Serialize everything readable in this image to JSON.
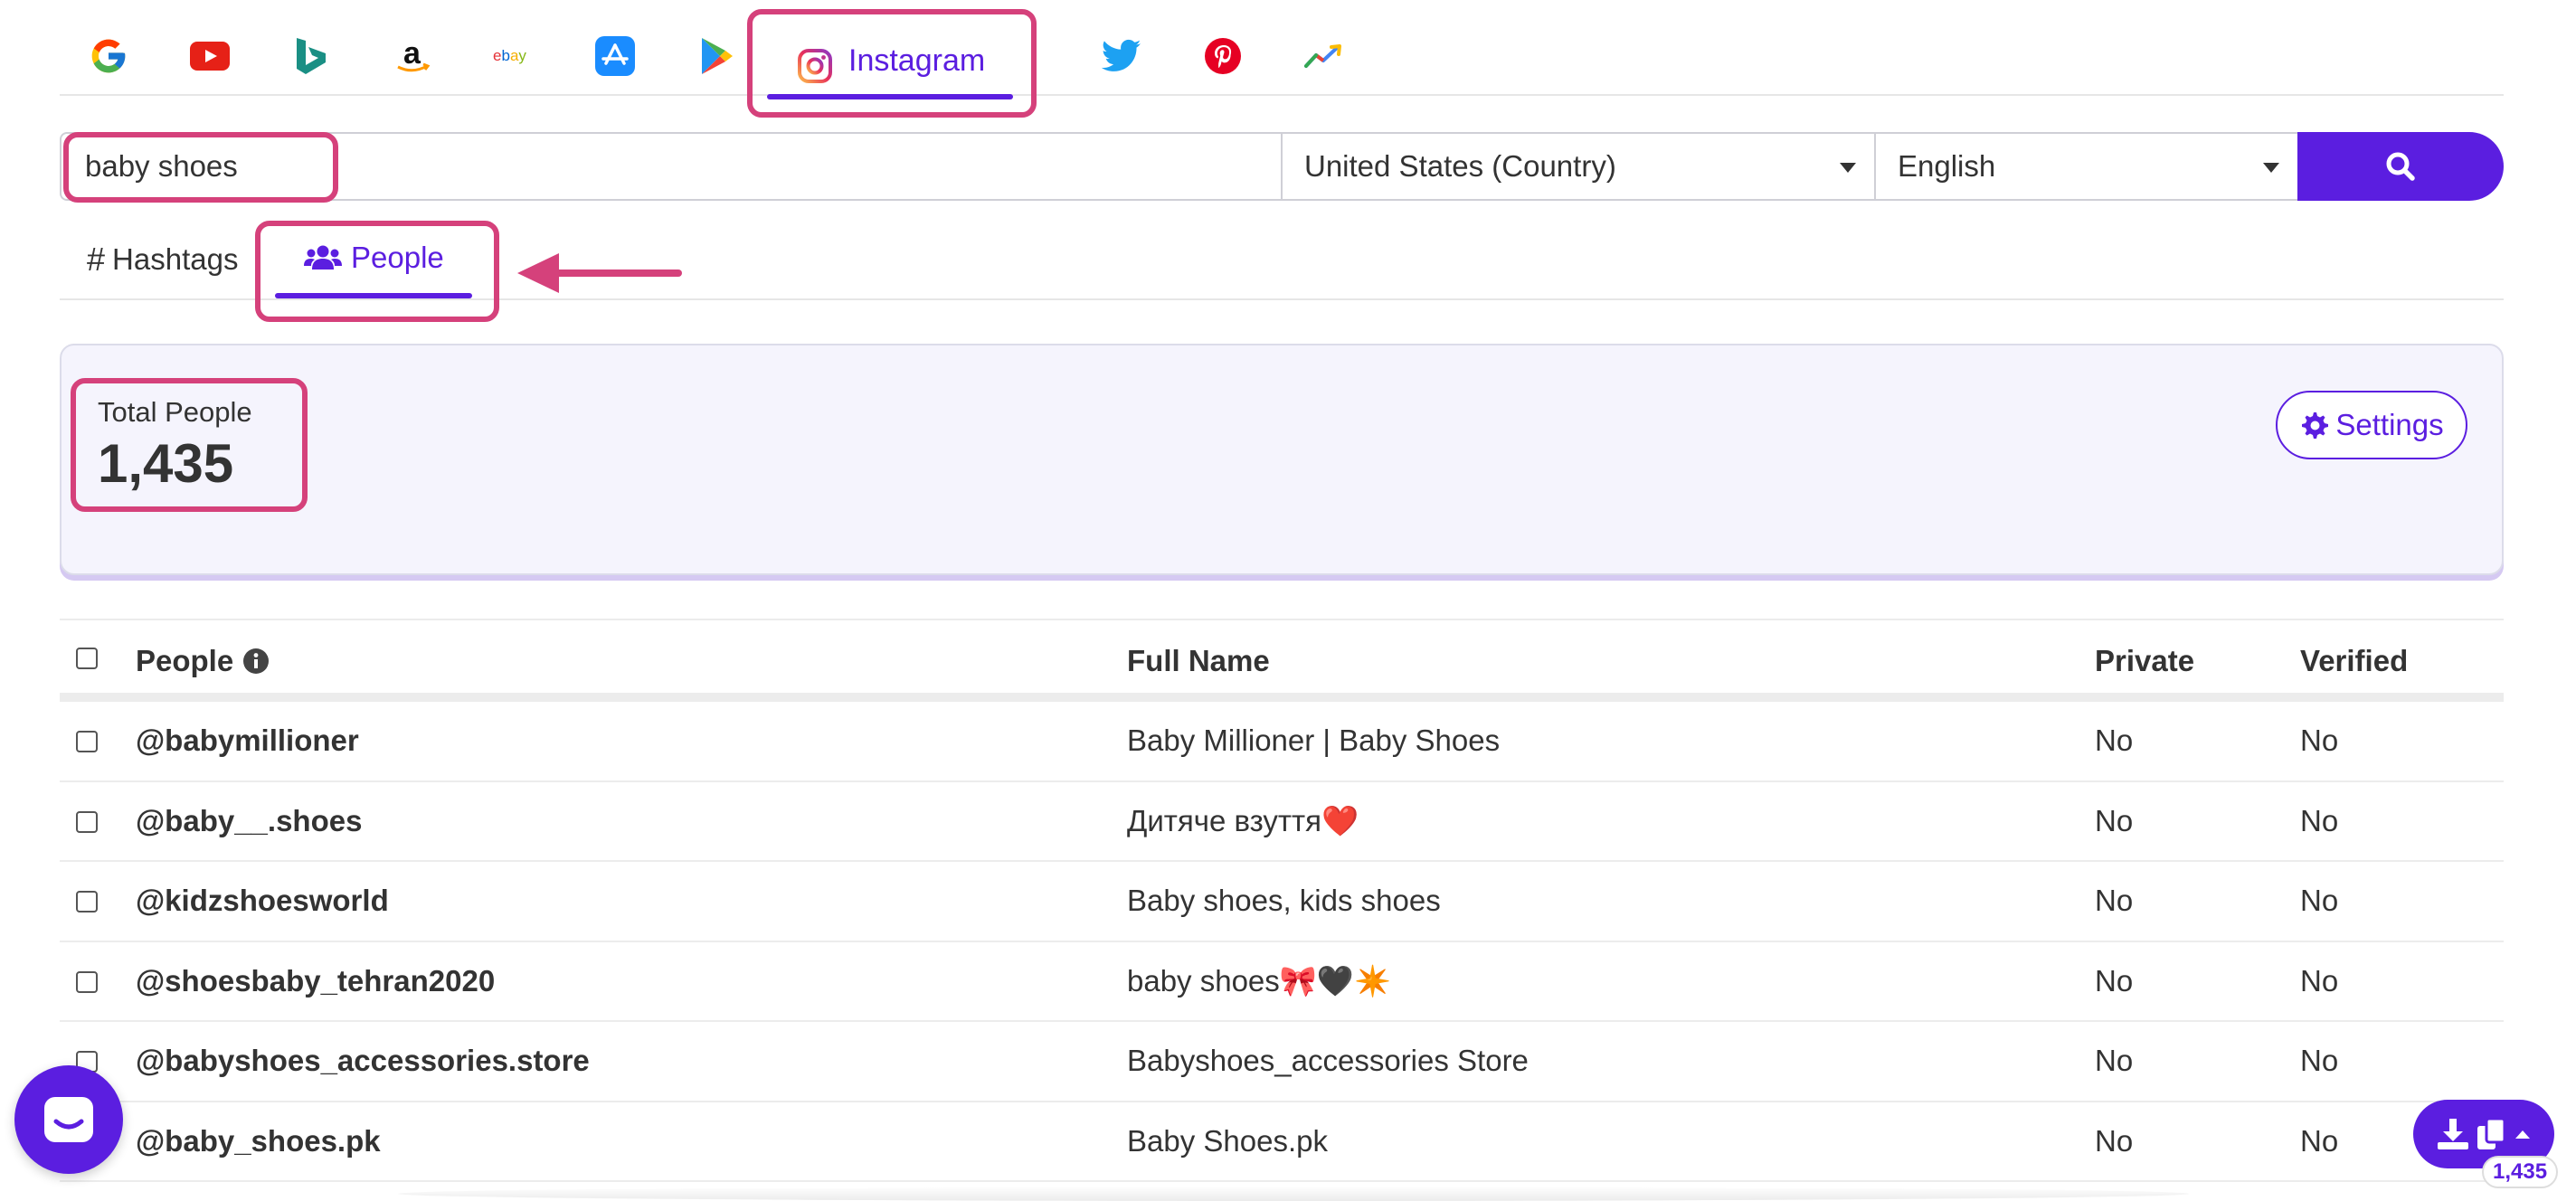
{
  "platforms": {
    "google": "google-icon",
    "youtube": "youtube-icon",
    "bing": "bing-icon",
    "amazon": "amazon-icon",
    "ebay": "ebay",
    "appstore": "app-store-icon",
    "playstore": "play-store-icon",
    "instagram_label": "Instagram",
    "twitter": "twitter-icon",
    "pinterest": "pinterest-icon",
    "trends": "trends-icon",
    "active": "Instagram"
  },
  "search": {
    "keyword": "baby shoes",
    "country": "United States (Country)",
    "language": "English",
    "button_icon": "search-icon"
  },
  "subtabs": {
    "hashtags_label": "Hashtags",
    "people_label": "People",
    "active": "People"
  },
  "summary": {
    "total_label": "Total People",
    "total_value": "1,435",
    "settings_label": "Settings"
  },
  "table": {
    "columns": {
      "people": "People",
      "full_name": "Full Name",
      "private": "Private",
      "verified": "Verified"
    },
    "rows": [
      {
        "handle": "@babymillioner",
        "full_name": "Baby Millioner | Baby Shoes",
        "private": "No",
        "verified": "No"
      },
      {
        "handle": "@baby__.shoes",
        "full_name": "Дитяче взуття❤️",
        "private": "No",
        "verified": "No"
      },
      {
        "handle": "@kidzshoesworld",
        "full_name": "Baby shoes, kids shoes",
        "private": "No",
        "verified": "No"
      },
      {
        "handle": "@shoesbaby_tehran2020",
        "full_name": "baby shoes🎀🖤✴️",
        "private": "No",
        "verified": "No"
      },
      {
        "handle": "@babyshoes_accessories.store",
        "full_name": "Babyshoes_accessories Store",
        "private": "No",
        "verified": "No"
      },
      {
        "handle": "@baby_shoes.pk",
        "full_name": "Baby Shoes.pk",
        "private": "No",
        "verified": "No"
      }
    ]
  },
  "export": {
    "count": "1,435"
  },
  "colors": {
    "accent": "#5b1ee0",
    "highlight": "#d5417b",
    "panel_bg": "#f5f4fd"
  }
}
